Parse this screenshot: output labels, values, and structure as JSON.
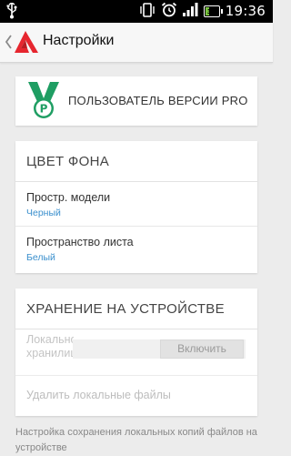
{
  "status_bar": {
    "time": "19:36",
    "battery_label": "30",
    "battery_level": 0.3,
    "colors": {
      "background": "#000000",
      "battery": "#79c340"
    },
    "icons": [
      "usb-icon",
      "vibrate-icon",
      "alarm-icon",
      "signal-icon",
      "battery-icon"
    ]
  },
  "app_bar": {
    "title": "Настройки",
    "icons": {
      "back": "chevron-left-icon",
      "logo": "autocad-logo-icon"
    },
    "brand_color": "#e6262f"
  },
  "pro": {
    "label": "ПОЛЬЗОВАТЕЛЬ ВЕРСИИ PRO",
    "badge_letter": "P",
    "badge_color": "#1f9e63"
  },
  "background_section": {
    "title": "ЦВЕТ ФОНА",
    "rows": [
      {
        "title": "Простр. модели",
        "value": "Черный"
      },
      {
        "title": "Пространство листа",
        "value": "Белый"
      }
    ],
    "value_color": "#3a8fcd"
  },
  "storage_section": {
    "title": "ХРАНЕНИЕ НА УСТРОЙСТВЕ",
    "local_label": "Локальное хранилище",
    "enable_button": "Включить",
    "delete_label": "Удалить локальные файлы"
  },
  "footer_note": "Настройка сохранения локальных копий файлов на устройстве"
}
